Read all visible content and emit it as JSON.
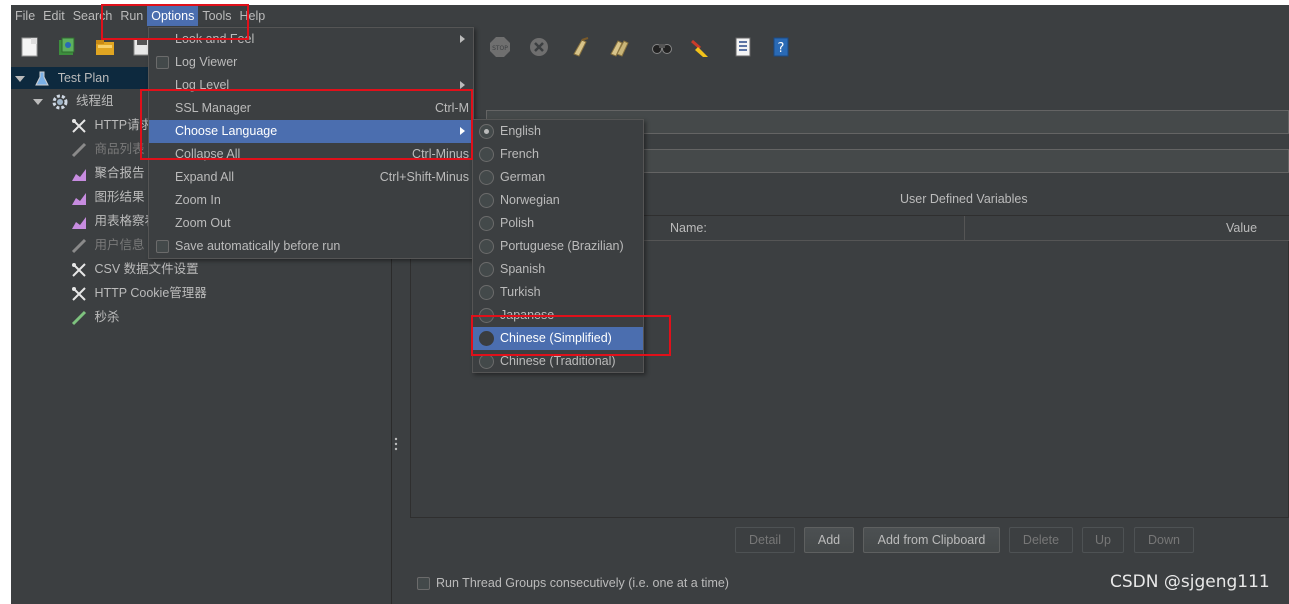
{
  "menubar": {
    "items": [
      "File",
      "Edit",
      "Search",
      "Run",
      "Options",
      "Tools",
      "Help"
    ],
    "active": "Options"
  },
  "tree": {
    "items": [
      {
        "label": "Test Plan"
      },
      {
        "label": "线程组"
      },
      {
        "label": "HTTP请求"
      },
      {
        "label": "商品列表"
      },
      {
        "label": "聚合报告"
      },
      {
        "label": "图形结果"
      },
      {
        "label": "用表格察看"
      },
      {
        "label": "用户信息"
      },
      {
        "label": "CSV 数据文件设置"
      },
      {
        "label": "HTTP Cookie管理器"
      },
      {
        "label": "秒杀"
      }
    ]
  },
  "options_menu": {
    "items": [
      {
        "label": "Look and Feel",
        "accel": "",
        "submenu": true
      },
      {
        "label": "Log Viewer",
        "accel": "",
        "checkbox": true
      },
      {
        "label": "Log Level",
        "accel": "",
        "submenu": true
      },
      {
        "label": "SSL Manager",
        "accel": "Ctrl-M"
      },
      {
        "label": "Choose Language",
        "accel": "",
        "submenu": true,
        "highlighted": true
      },
      {
        "label": "Collapse All",
        "accel": "Ctrl-Minus"
      },
      {
        "label": "Expand All",
        "accel": "Ctrl+Shift-Minus"
      },
      {
        "label": "Zoom In",
        "accel": ""
      },
      {
        "label": "Zoom Out",
        "accel": ""
      },
      {
        "label": "Save automatically before run",
        "accel": "",
        "checkbox": true
      }
    ]
  },
  "language_menu": {
    "items": [
      {
        "label": "English",
        "selected": true
      },
      {
        "label": "French"
      },
      {
        "label": "German"
      },
      {
        "label": "Norwegian"
      },
      {
        "label": "Polish"
      },
      {
        "label": "Portuguese (Brazilian)"
      },
      {
        "label": "Spanish"
      },
      {
        "label": "Turkish"
      },
      {
        "label": "Japanese"
      },
      {
        "label": "Chinese (Simplified)",
        "highlighted": true
      },
      {
        "label": "Chinese (Traditional)"
      }
    ]
  },
  "main": {
    "udv_title": "User Defined Variables",
    "col_name": "Name:",
    "col_value": "Value",
    "buttons": {
      "detail": "Detail",
      "add": "Add",
      "add_clipboard": "Add from Clipboard",
      "delete": "Delete",
      "up": "Up",
      "down": "Down"
    },
    "run_consecutively": "Run Thread Groups consecutively (i.e. one at a time)"
  },
  "watermark": "CSDN @sjgeng111",
  "colors": {
    "background": "#3c3f41",
    "highlight": "#4b6eaf",
    "annotation": "#e0101a"
  }
}
